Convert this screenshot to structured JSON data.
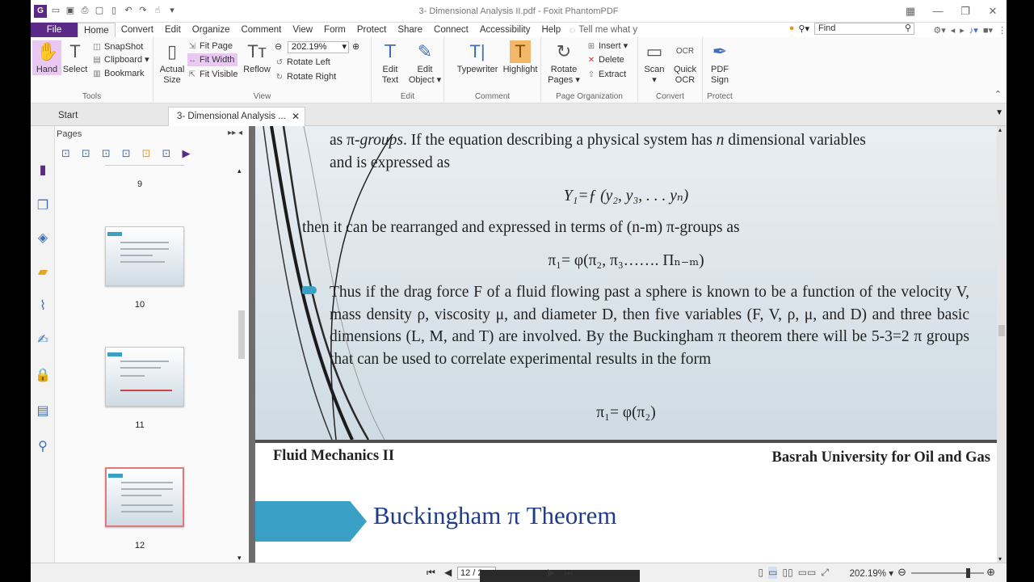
{
  "window": {
    "title": "3- Dimensional Analysis II.pdf - Foxit PhantomPDF"
  },
  "menu": {
    "file": "File",
    "tabs": [
      "Home",
      "Convert",
      "Edit",
      "Organize",
      "Comment",
      "View",
      "Form",
      "Protect",
      "Share",
      "Connect",
      "Accessibility",
      "Help"
    ],
    "tellme": "Tell me what y",
    "find_placeholder": "Find"
  },
  "ribbon": {
    "tools": {
      "label": "Tools",
      "hand": "Hand",
      "select": "Select",
      "snapshot": "SnapShot",
      "clipboard": "Clipboard",
      "bookmark": "Bookmark"
    },
    "view": {
      "label": "View",
      "actual_size_1": "Actual",
      "actual_size_2": "Size",
      "fit_page": "Fit Page",
      "fit_width": "Fit Width",
      "fit_visible": "Fit Visible",
      "reflow": "Reflow",
      "zoom": "202.19%",
      "rotate_left": "Rotate Left",
      "rotate_right": "Rotate Right"
    },
    "edit": {
      "label": "Edit",
      "edit_text_1": "Edit",
      "edit_text_2": "Text",
      "edit_object_1": "Edit",
      "edit_object_2": "Object"
    },
    "comment": {
      "label": "Comment",
      "typewriter": "Typewriter",
      "highlight": "Highlight"
    },
    "page_org": {
      "label": "Page Organization",
      "rotate_pages_1": "Rotate",
      "rotate_pages_2": "Pages",
      "insert": "Insert",
      "delete": "Delete",
      "extract": "Extract"
    },
    "convert": {
      "label": "Convert",
      "scan": "Scan",
      "quick_ocr_1": "Quick",
      "quick_ocr_2": "OCR"
    },
    "protect": {
      "label": "Protect",
      "pdf_sign_1": "PDF",
      "pdf_sign_2": "Sign"
    }
  },
  "doctabs": {
    "start": "Start",
    "document": "3- Dimensional Analysis ..."
  },
  "pages_panel": {
    "label": "Pages",
    "thumbnails": [
      "9",
      "10",
      "11",
      "12"
    ]
  },
  "document": {
    "p1_line1_a": "as π-",
    "p1_line1_groups": "groups",
    "p1_line1_b": ". If the equation describing a physical system has ",
    "p1_line1_n": "n",
    "p1_line1_c": " dimensional variables",
    "p1_line2": "and is expressed as",
    "eq1": "Y₁=ƒ (y₂, y₃, . . . yₙ)",
    "p1_line3": "then it can be rearranged and expressed in terms of (n-m) π-groups as",
    "eq2": "π₁= φ(π₂, π₃……. Πₙ₋ₘ)",
    "para2": "Thus if the drag force F of a fluid flowing past a sphere is known to be a function of the velocity V, mass density ρ, viscosity μ, and diameter D, then five variables (F, V, ρ, μ, and D) and three basic dimensions (L, M, and T) are involved. By the Buckingham π theorem there will be 5-3=2 π groups that can be used to correlate experimental results in the form",
    "eq3": "π₁= φ(π₂)",
    "p2_left": "Fluid Mechanics II",
    "p2_right": "Basrah University for Oil and Gas",
    "p2_title": "Buckingham π Theorem"
  },
  "statusbar": {
    "page": "12 / 2",
    "zoom": "202.19%"
  },
  "colors": {
    "accent": "#5b2a86",
    "slide_blue": "#3aa0c6",
    "title_blue": "#1f3c88"
  }
}
